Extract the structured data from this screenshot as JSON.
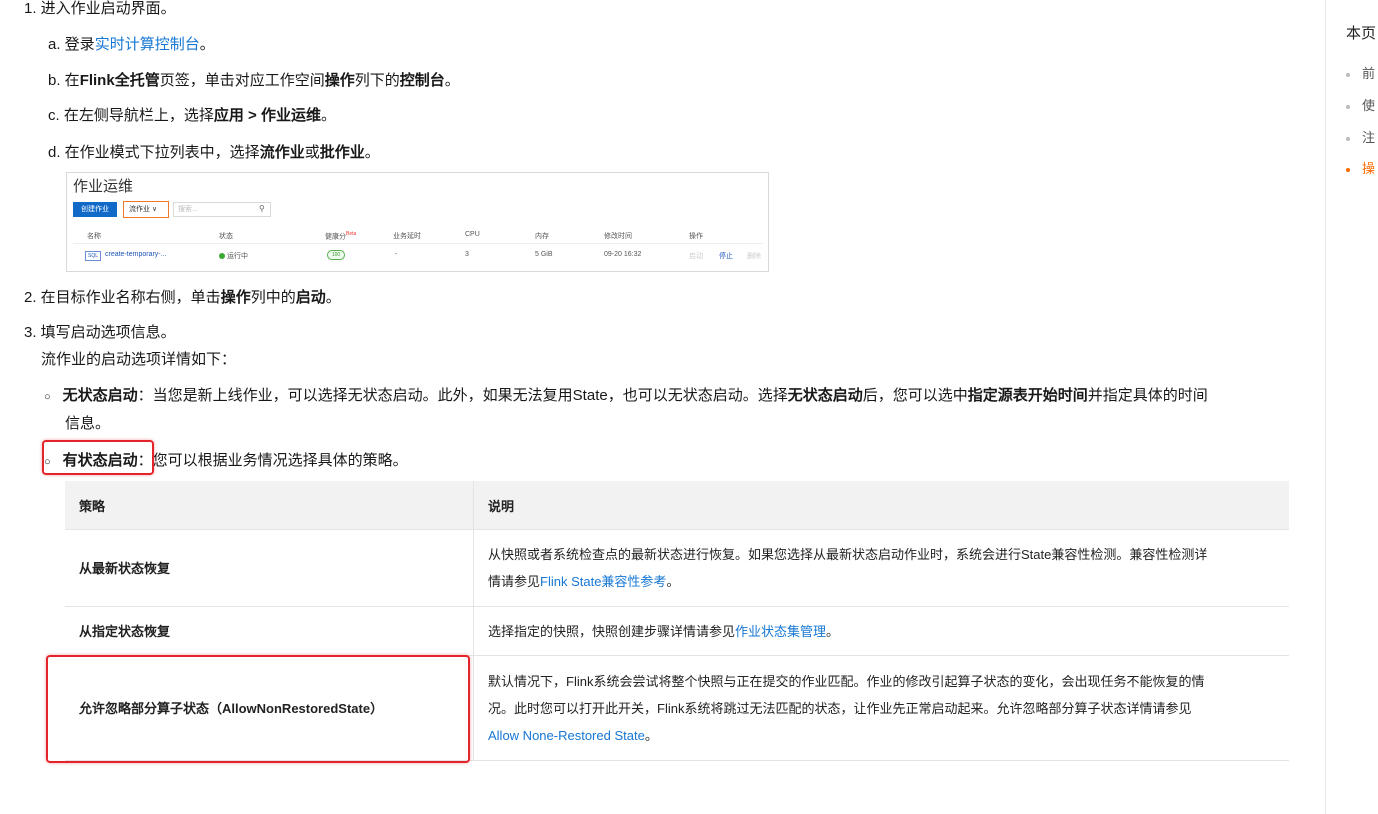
{
  "steps": {
    "step1": "1. 进入作业启动界面。",
    "a_prefix": "a. 登录",
    "a_link": "实时计算控制台",
    "a_suffix": "。",
    "b_1": "b. 在",
    "b_2": "Flink全托管",
    "b_3": "页签，单击对应工作空间",
    "b_4": "操作",
    "b_5": "列下的",
    "b_6": "控制台",
    "b_7": "。",
    "c_1": "c. 在左侧导航栏上，选择",
    "c_2": "应用 > 作业运维",
    "c_3": "。",
    "d_1": "d. 在作业模式下拉列表中，选择",
    "d_2": "流作业",
    "d_3": "或",
    "d_4": "批作业",
    "d_5": "。",
    "step2_1": "2. 在目标作业名称右侧，单击",
    "step2_2": "操作",
    "step2_3": "列中的",
    "step2_4": "启动",
    "step2_5": "。",
    "step3": "3. 填写启动选项信息。",
    "step3_sub": "流作业的启动选项详情如下：",
    "bullet1_1": "无状态启动",
    "bullet1_2": "：当您是新上线作业，可以选择无状态启动。此外，如果无法复用State，也可以无状态启动。选择",
    "bullet1_3": "无状态启动",
    "bullet1_4": "后，您可以选中",
    "bullet1_5": "指定源表开始时间",
    "bullet1_6": "并指定具体的时间",
    "bullet1_7": "信息。",
    "bullet2_1": "有状态启动",
    "bullet2_2": "：您可以根据业务情况选择具体的策略。"
  },
  "screenshot": {
    "title": "作业运维",
    "create_btn": "创建作业",
    "mode_select": "流作业 ∨",
    "search_placeholder": "搜索...",
    "headers": [
      "名称",
      "状态",
      "健康分",
      "Beta",
      "业务延时",
      "CPU",
      "内存",
      "修改时间",
      "操作"
    ],
    "row": {
      "badge": "SQL",
      "name": "create-temporary-...",
      "status": "运行中",
      "health": "100",
      "delay": "-",
      "cpu": "3",
      "mem": "5 GiB",
      "time": "09-20 16:32",
      "action_start": "启动",
      "action_stop": "停止",
      "action_delete": "删除"
    }
  },
  "table": {
    "headers": [
      "策略",
      "说明"
    ],
    "rows": [
      {
        "strategy": "从最新状态恢复",
        "desc_1": "从快照或者系统检查点的最新状态进行恢复。如果您选择从最新状态启动作业时，系统会进行State兼容性检测。兼容性检测详",
        "desc_2": "情请参见",
        "desc_link": "Flink State兼容性参考",
        "desc_3": "。"
      },
      {
        "strategy": "从指定状态恢复",
        "desc_1": "选择指定的快照，快照创建步骤详情请参见",
        "desc_link": "作业状态集管理",
        "desc_3": "。"
      },
      {
        "strategy": "允许忽略部分算子状态（AllowNonRestoredState）",
        "desc_1": "默认情况下，Flink系统会尝试将整个快照与正在提交的作业匹配。作业的修改引起算子状态的变化，会出现任务不能恢复的情",
        "desc_2": "况。此时您可以打开此开关，Flink系统将跳过无法匹配的状态，让作业先正常启动起来。允许忽略部分算子状态详情请参见",
        "desc_link": "Allow None-Restored State",
        "desc_3": "。"
      }
    ]
  },
  "toc": {
    "title": "本页",
    "items": [
      "前",
      "使",
      "注",
      "操"
    ],
    "active_color": "#ff6a00"
  },
  "colors": {
    "link": "#1677d4",
    "highlight_box": "#e3242b"
  }
}
